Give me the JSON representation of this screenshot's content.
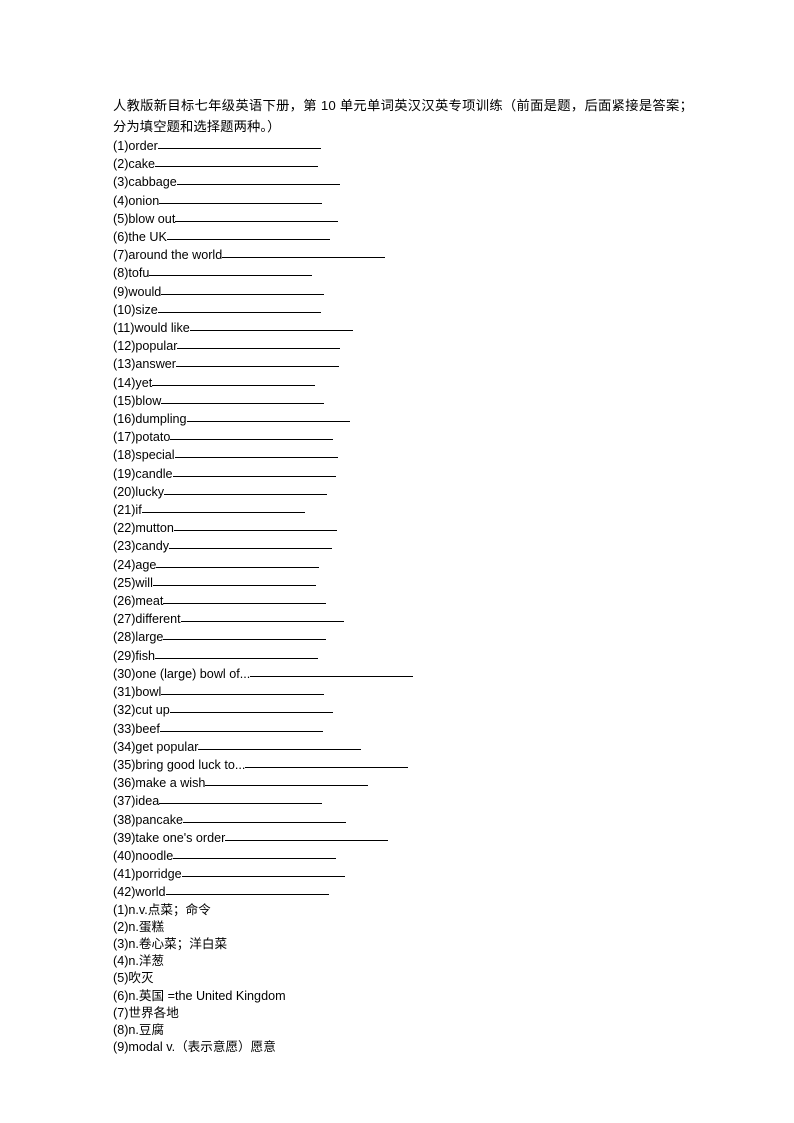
{
  "document": {
    "title": "人教版新目标七年级英语下册，第 10 单元单词英汉汉英专项训练（前面是题，后面紧接是答案；分为填空题和选择题两种。）",
    "questions": [
      {
        "number": "(1)",
        "term": "order",
        "blank_width": 163
      },
      {
        "number": "(2)",
        "term": "cake",
        "blank_width": 163
      },
      {
        "number": "(3)",
        "term": "cabbage",
        "blank_width": 163
      },
      {
        "number": "(4)",
        "term": "onion",
        "blank_width": 163
      },
      {
        "number": "(5)",
        "term": "blow out",
        "blank_width": 163
      },
      {
        "number": "(6)",
        "term": "the UK",
        "blank_width": 163
      },
      {
        "number": "(7)",
        "term": "around the world",
        "blank_width": 163
      },
      {
        "number": "(8)",
        "term": "tofu",
        "blank_width": 163
      },
      {
        "number": "(9)",
        "term": "would",
        "blank_width": 163
      },
      {
        "number": "(10)",
        "term": "size",
        "blank_width": 163
      },
      {
        "number": "(11)",
        "term": "would like",
        "blank_width": 163
      },
      {
        "number": "(12)",
        "term": "popular",
        "blank_width": 163
      },
      {
        "number": "(13)",
        "term": "answer",
        "blank_width": 163
      },
      {
        "number": "(14)",
        "term": "yet",
        "blank_width": 163
      },
      {
        "number": "(15)",
        "term": "blow",
        "blank_width": 163
      },
      {
        "number": "(16)",
        "term": "dumpling",
        "blank_width": 163
      },
      {
        "number": "(17)",
        "term": "potato",
        "blank_width": 163
      },
      {
        "number": "(18)",
        "term": "special",
        "blank_width": 163
      },
      {
        "number": "(19)",
        "term": "candle",
        "blank_width": 163
      },
      {
        "number": "(20)",
        "term": "lucky",
        "blank_width": 163
      },
      {
        "number": "(21)",
        "term": "if",
        "blank_width": 163
      },
      {
        "number": "(22)",
        "term": "mutton",
        "blank_width": 163
      },
      {
        "number": "(23)",
        "term": "candy",
        "blank_width": 163
      },
      {
        "number": "(24)",
        "term": "age",
        "blank_width": 163
      },
      {
        "number": "(25)",
        "term": "will",
        "blank_width": 163
      },
      {
        "number": "(26)",
        "term": "meat",
        "blank_width": 163
      },
      {
        "number": "(27)",
        "term": "different",
        "blank_width": 163
      },
      {
        "number": "(28)",
        "term": "large",
        "blank_width": 163
      },
      {
        "number": "(29)",
        "term": "fish",
        "blank_width": 163
      },
      {
        "number": "(30)",
        "term": "one (large) bowl of...",
        "blank_width": 163
      },
      {
        "number": "(31)",
        "term": "bowl",
        "blank_width": 163
      },
      {
        "number": "(32)",
        "term": "cut up",
        "blank_width": 163
      },
      {
        "number": "(33)",
        "term": "beef",
        "blank_width": 163
      },
      {
        "number": "(34)",
        "term": "get popular",
        "blank_width": 163
      },
      {
        "number": "(35)",
        "term": "bring good luck to...",
        "blank_width": 163
      },
      {
        "number": "(36)",
        "term": "make a wish",
        "blank_width": 163
      },
      {
        "number": "(37)",
        "term": "idea",
        "blank_width": 163
      },
      {
        "number": "(38)",
        "term": "pancake",
        "blank_width": 163
      },
      {
        "number": "(39)",
        "term": "take one's order",
        "blank_width": 163
      },
      {
        "number": "(40)",
        "term": "noodle",
        "blank_width": 163
      },
      {
        "number": "(41)",
        "term": "porridge",
        "blank_width": 163
      },
      {
        "number": "(42)",
        "term": "world",
        "blank_width": 163
      }
    ],
    "answers": [
      {
        "number": "(1)",
        "text": "n.v.点菜；命令"
      },
      {
        "number": "(2)",
        "text": "n.蛋糕"
      },
      {
        "number": "(3)",
        "text": "n.卷心菜；洋白菜"
      },
      {
        "number": "(4)",
        "text": "n.洋葱"
      },
      {
        "number": "(5)",
        "text": "吹灭"
      },
      {
        "number": "(6)",
        "text": "n.英国  =the United Kingdom"
      },
      {
        "number": "(7)",
        "text": "世界各地"
      },
      {
        "number": "(8)",
        "text": "n.豆腐"
      },
      {
        "number": "(9)",
        "text": "modal v.（表示意愿）愿意"
      }
    ]
  }
}
